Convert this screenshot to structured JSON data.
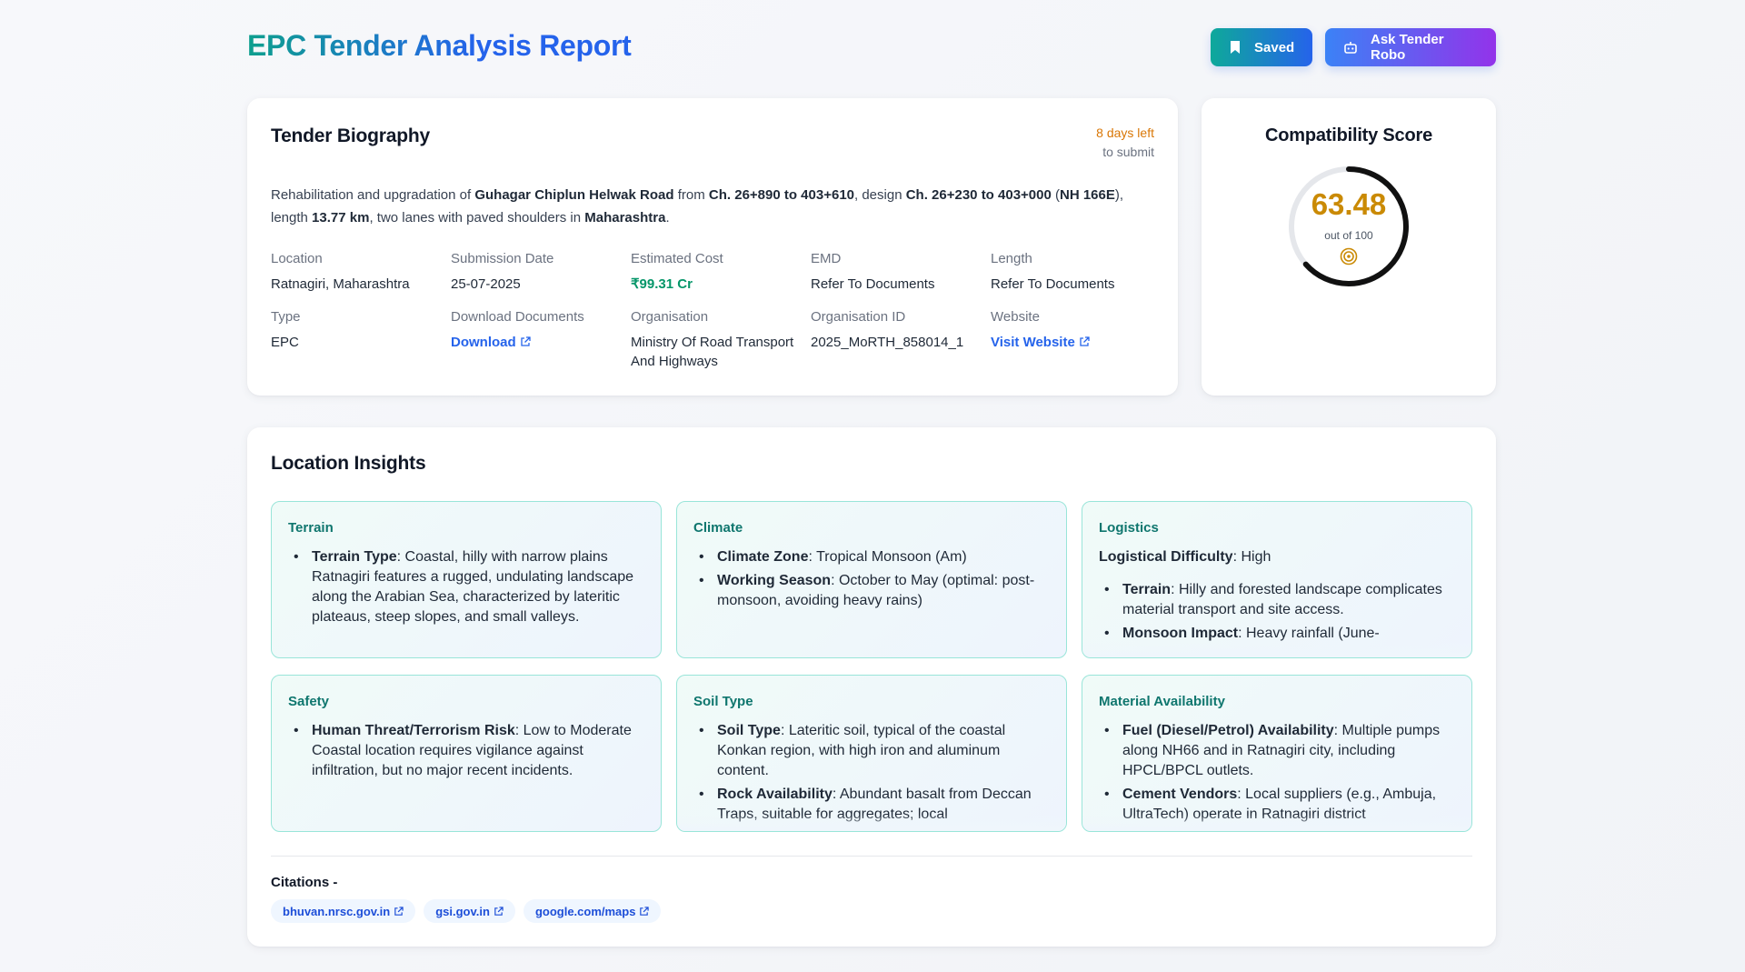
{
  "header": {
    "title": "EPC Tender Analysis Report",
    "saved_label": "Saved",
    "robo_label": "Ask Tender Robo"
  },
  "biography": {
    "title": "Tender Biography",
    "days_left": "8 days left",
    "days_sub": "to submit",
    "description": {
      "t1": "Rehabilitation and upgradation of ",
      "b1": "Guhagar Chiplun Helwak Road",
      "t2": " from ",
      "b2": "Ch. 26+890 to 403+610",
      "t3": ", design ",
      "b3": "Ch. 26+230 to 403+000",
      "t4": " (",
      "b4": "NH 166E",
      "t5": "), length ",
      "b5": "13.77 km",
      "t6": ", two lanes with paved shoulders in ",
      "b6": "Maharashtra",
      "t7": "."
    },
    "fields": {
      "location": {
        "label": "Location",
        "value": "Ratnagiri, Maharashtra"
      },
      "submission_date": {
        "label": "Submission Date",
        "value": "25-07-2025"
      },
      "estimated_cost": {
        "label": "Estimated Cost",
        "value": "₹99.31 Cr"
      },
      "emd": {
        "label": "EMD",
        "value": "Refer To Documents"
      },
      "length": {
        "label": "Length",
        "value": "Refer To Documents"
      },
      "type": {
        "label": "Type",
        "value": "EPC"
      },
      "download_documents": {
        "label": "Download Documents",
        "value": "Download"
      },
      "organisation": {
        "label": "Organisation",
        "value": "Ministry Of Road Transport And Highways"
      },
      "organisation_id": {
        "label": "Organisation ID",
        "value": "2025_MoRTH_858014_1"
      },
      "website": {
        "label": "Website",
        "value": "Visit Website"
      }
    }
  },
  "compatibility": {
    "title": "Compatibility Score",
    "score": "63.48",
    "score_value": 63.48,
    "out_of": "out of 100",
    "icon": "target-icon"
  },
  "insights": {
    "title": "Location Insights",
    "terrain": {
      "title": "Terrain",
      "items": [
        {
          "key": "Terrain Type",
          "text": ": Coastal, hilly with narrow plains",
          "extra": "Ratnagiri features a rugged, undulating landscape along the Arabian Sea, characterized by lateritic plateaus, steep slopes, and small valleys."
        }
      ]
    },
    "climate": {
      "title": "Climate",
      "items": [
        {
          "key": "Climate Zone",
          "text": ": Tropical Monsoon (Am)"
        },
        {
          "key": "Working Season",
          "text": ": October to May (optimal: post-monsoon, avoiding heavy rains)"
        }
      ]
    },
    "logistics": {
      "title": "Logistics",
      "lead_key": "Logistical Difficulty",
      "lead_text": ": High",
      "items": [
        {
          "key": "Terrain",
          "text": ": Hilly and forested landscape complicates material transport and site access."
        },
        {
          "key": "Monsoon Impact",
          "text": ": Heavy rainfall (June-"
        }
      ]
    },
    "safety": {
      "title": "Safety",
      "items": [
        {
          "key": "Human Threat/Terrorism Risk",
          "text": ": Low to Moderate",
          "extra": "Coastal location requires vigilance against infiltration, but no major recent incidents."
        }
      ]
    },
    "soil": {
      "title": "Soil Type",
      "items": [
        {
          "key": "Soil Type",
          "text": ": Lateritic soil, typical of the coastal Konkan region, with high iron and aluminum content."
        },
        {
          "key": "Rock Availability",
          "text": ": Abundant basalt from Deccan Traps, suitable for aggregates; local"
        }
      ]
    },
    "material": {
      "title": "Material Availability",
      "items": [
        {
          "key": "Fuel (Diesel/Petrol) Availability",
          "text": ": Multiple pumps along NH66 and in Ratnagiri city, including HPCL/BPCL outlets."
        },
        {
          "key": "Cement Vendors",
          "text": ": Local suppliers (e.g., Ambuja, UltraTech) operate in Ratnagiri district"
        }
      ]
    },
    "citations_label": "Citations -",
    "citations": [
      "bhuvan.nrsc.gov.in",
      "gsi.gov.in",
      "google.com/maps"
    ]
  },
  "colors": {
    "accent_teal": "#0ea99a",
    "accent_blue": "#2563eb",
    "accent_purple": "#9333ea",
    "score_gold": "#ca8a04",
    "days_orange": "#d97706",
    "cost_green": "#059669"
  }
}
